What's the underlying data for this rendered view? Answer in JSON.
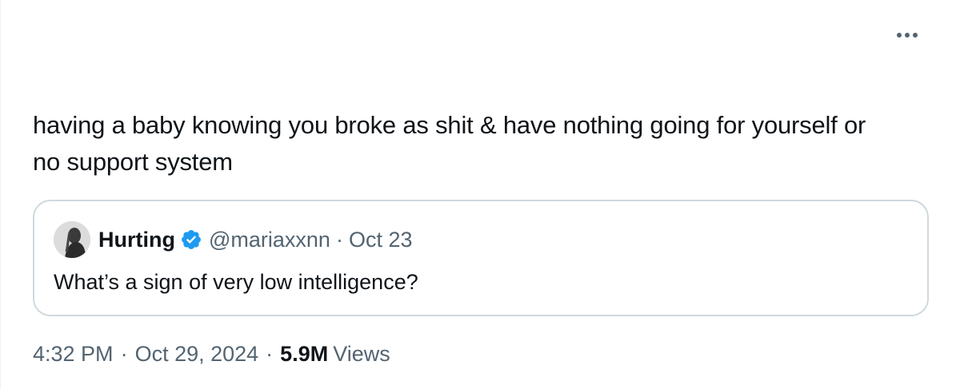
{
  "tweet": {
    "text": "having a baby knowing you broke as shit & have nothing going for yourself or no support system",
    "more_icon": "more-horizontal-icon"
  },
  "quote": {
    "name": "Hurting",
    "verified": true,
    "verified_color": "#1d9bf0",
    "handle": "@mariaxxnn",
    "separator": "·",
    "date": "Oct 23",
    "text": "What’s a sign of very low intelligence?"
  },
  "meta": {
    "time": "4:32 PM",
    "separator1": "·",
    "date": "Oct 29, 2024",
    "separator2": "·",
    "views_count": "5.9M",
    "views_label": "Views"
  },
  "colors": {
    "text_primary": "#0f1419",
    "text_secondary": "#536471",
    "border": "#cfd9de",
    "verified": "#1d9bf0"
  }
}
